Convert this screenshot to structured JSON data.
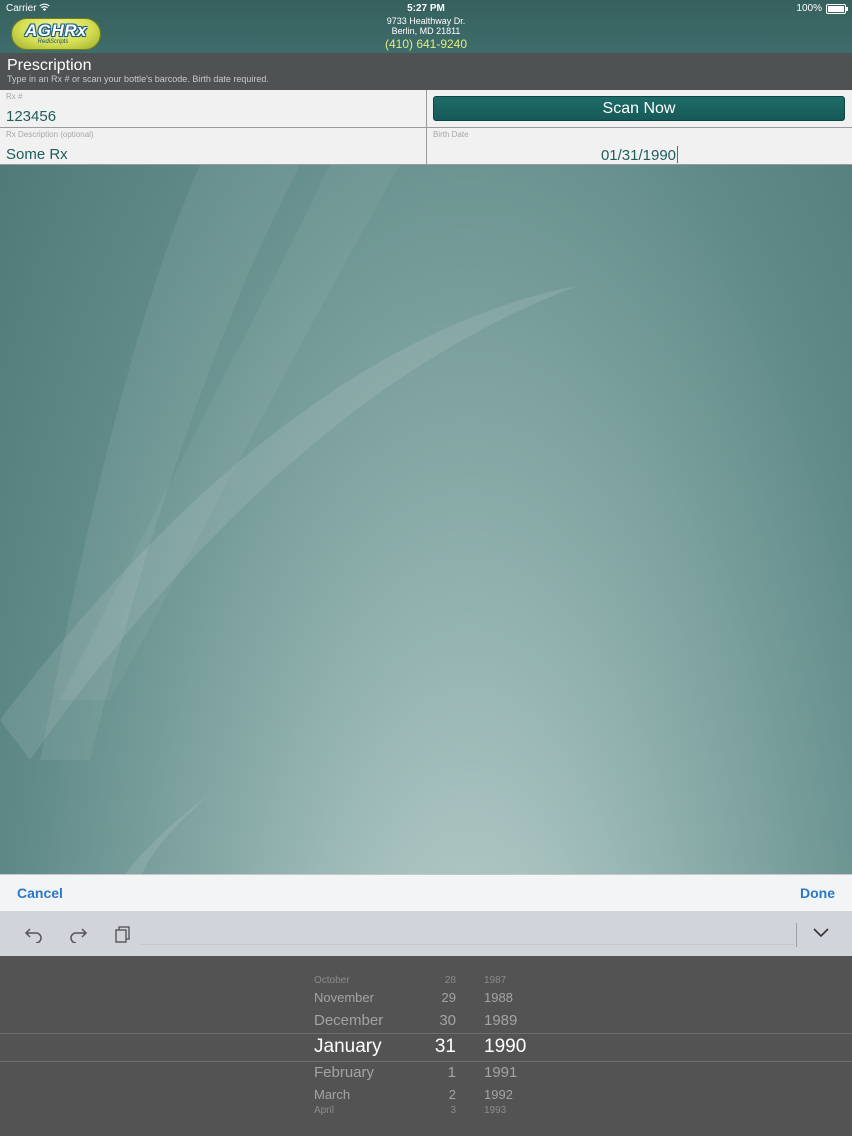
{
  "status_bar": {
    "carrier": "Carrier",
    "time": "5:27 PM",
    "battery": "100%",
    "wifi_icon": "wifi-icon",
    "battery_icon": "battery-icon"
  },
  "header": {
    "logo_text": "AGHRx",
    "logo_sub": "RediScripts",
    "address_line1": "9733 Healthway Dr.",
    "address_line2": "Berlin, MD 21811",
    "phone": "(410) 641-9240",
    "phone_color": "#e2ec7c"
  },
  "prescription": {
    "title": "Prescription",
    "subtitle": "Type in an Rx # or scan your bottle's barcode. Birth date required.",
    "rx_label": "Rx #",
    "rx_value": "123456",
    "scan_button": "Scan Now",
    "desc_label": "Rx Description (optional)",
    "desc_value": "Some Rx",
    "birth_label": "Birth Date",
    "birth_value": "01/31/1990"
  },
  "picker_toolbar": {
    "cancel": "Cancel",
    "done": "Done",
    "accent": "#2a78c8"
  },
  "keyboard_bar": {
    "icons": [
      "undo-icon",
      "redo-icon",
      "paste-icon",
      "chevron-down-icon"
    ]
  },
  "date_picker": {
    "months": [
      "October",
      "November",
      "December",
      "January",
      "February",
      "March",
      "April"
    ],
    "days": [
      "28",
      "29",
      "30",
      "31",
      "1",
      "2",
      "3"
    ],
    "years": [
      "1987",
      "1988",
      "1989",
      "1990",
      "1991",
      "1992",
      "1993"
    ],
    "selected": {
      "month": "January",
      "day": "31",
      "year": "1990"
    }
  },
  "colors": {
    "header_bg": "#3f6d6b",
    "section_bg": "#4f5252",
    "scan_button_bg": "#1f6b69",
    "value_text": "#1d5e5b"
  }
}
